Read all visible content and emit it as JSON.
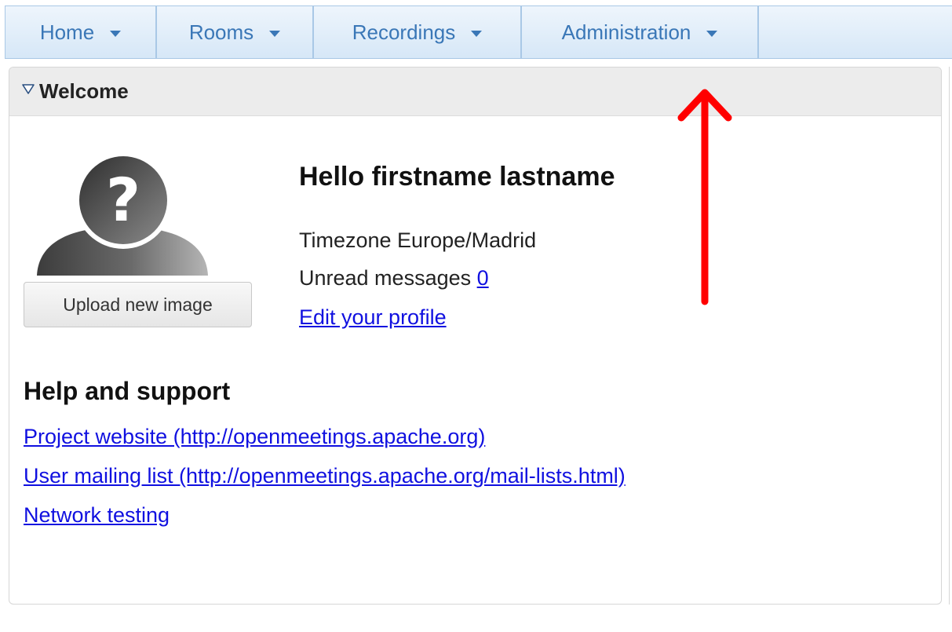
{
  "menu": {
    "items": [
      {
        "label": "Home"
      },
      {
        "label": "Rooms"
      },
      {
        "label": "Recordings"
      },
      {
        "label": "Administration"
      }
    ]
  },
  "welcome_panel": {
    "title": "Welcome",
    "upload_button_label": "Upload new image",
    "greeting": "Hello firstname lastname",
    "timezone_text": "Timezone Europe/Madrid",
    "unread_label": "Unread messages",
    "unread_count": "0",
    "edit_profile_label": "Edit your profile"
  },
  "help": {
    "title": "Help and support",
    "links": [
      {
        "label": "Project website (http://openmeetings.apache.org)"
      },
      {
        "label": "User mailing list (http://openmeetings.apache.org/mail-lists.html)"
      },
      {
        "label": "Network testing"
      }
    ]
  },
  "colors": {
    "menu_text": "#3a77b7",
    "link": "#1010e0",
    "annotation_arrow": "#ff0000"
  },
  "icons": {
    "collapse": "triangle-down-icon",
    "avatar": "unknown-user-avatar-icon",
    "annotation": "red-arrow-up-icon"
  }
}
